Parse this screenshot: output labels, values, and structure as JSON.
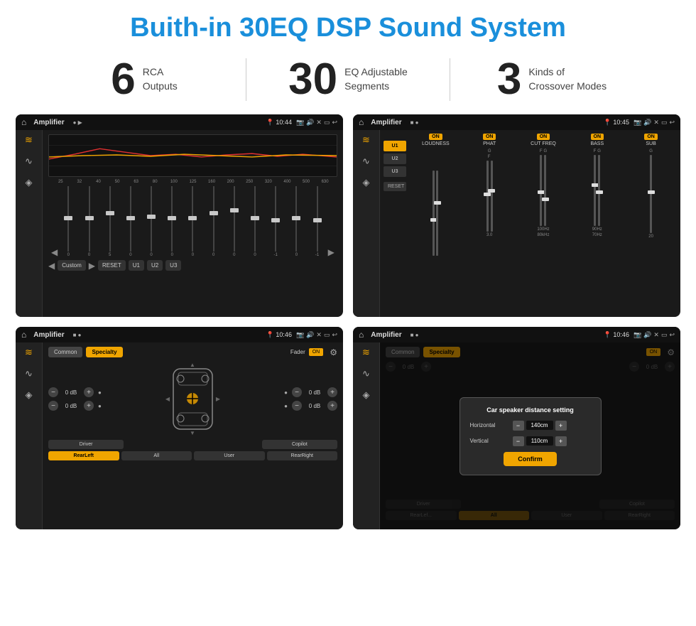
{
  "page": {
    "title": "Buith-in 30EQ DSP Sound System",
    "title_color": "#1a8fdb"
  },
  "stats": [
    {
      "number": "6",
      "label": "RCA\nOutputs"
    },
    {
      "number": "30",
      "label": "EQ Adjustable\nSegments"
    },
    {
      "number": "3",
      "label": "Kinds of\nCrossover Modes"
    }
  ],
  "screens": {
    "screen1": {
      "title": "Amplifier",
      "time": "10:44",
      "type": "eq",
      "freqs": [
        "25",
        "32",
        "40",
        "50",
        "63",
        "80",
        "100",
        "125",
        "160",
        "200",
        "250",
        "320",
        "400",
        "500",
        "630"
      ],
      "preset_label": "Custom",
      "buttons": [
        "RESET",
        "U1",
        "U2",
        "U3"
      ]
    },
    "screen2": {
      "title": "Amplifier",
      "time": "10:45",
      "type": "crossover",
      "presets": [
        "U1",
        "U2",
        "U3"
      ],
      "columns": [
        "LOUDNESS",
        "PHAT",
        "CUT FREQ",
        "BASS",
        "SUB"
      ],
      "reset_label": "RESET"
    },
    "screen3": {
      "title": "Amplifier",
      "time": "10:46",
      "type": "fader",
      "tabs": [
        "Common",
        "Specialty"
      ],
      "active_tab": "Specialty",
      "fader_label": "Fader",
      "on_label": "ON",
      "buttons": [
        "Driver",
        "Copilot",
        "RearLeft",
        "All",
        "User",
        "RearRight"
      ]
    },
    "screen4": {
      "title": "Amplifier",
      "time": "10:46",
      "type": "fader_dialog",
      "tabs": [
        "Common",
        "Specialty"
      ],
      "dialog": {
        "title": "Car speaker distance setting",
        "horizontal_label": "Horizontal",
        "horizontal_value": "140cm",
        "vertical_label": "Vertical",
        "vertical_value": "110cm",
        "confirm_label": "Confirm"
      },
      "buttons": [
        "Driver",
        "Copilot",
        "RearLeft",
        "All",
        "User",
        "RearRight"
      ]
    }
  },
  "icons": {
    "home": "⌂",
    "location": "📍",
    "volume": "🔊",
    "back": "↩",
    "camera": "📷",
    "eq_icon": "≋",
    "wave_icon": "∿",
    "speaker_icon": "◈",
    "arrow_up": "▲",
    "arrow_down": "▼",
    "arrow_left": "◀",
    "arrow_right": "▶",
    "plus": "+",
    "minus": "−"
  }
}
